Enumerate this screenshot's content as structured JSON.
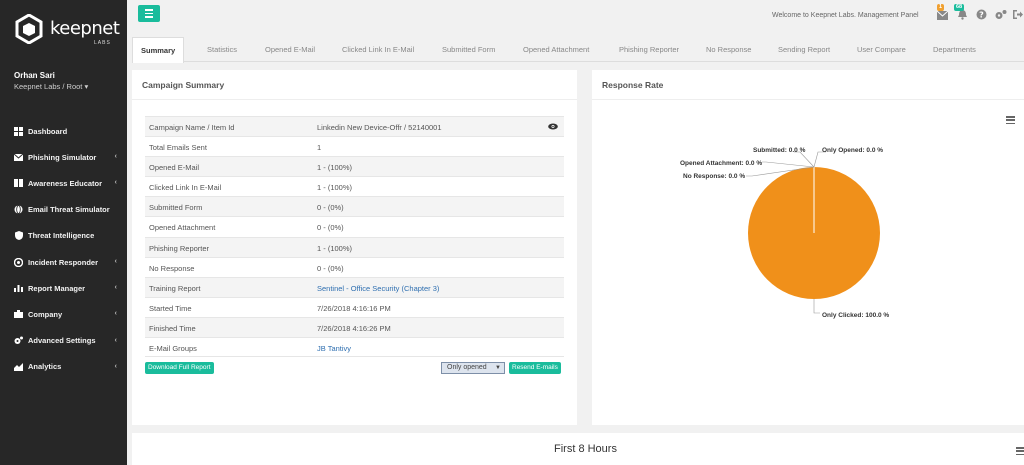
{
  "brand": {
    "name": "keepnet",
    "sub": "LABS"
  },
  "user": {
    "name": "Orhan Sari",
    "org": "Keepnet Labs / Root ▾"
  },
  "sidebar": {
    "items": [
      {
        "label": "Dashboard",
        "icon": "dashboard-icon",
        "has_children": false
      },
      {
        "label": "Phishing Simulator",
        "icon": "envelope-icon",
        "has_children": true
      },
      {
        "label": "Awareness Educator",
        "icon": "book-icon",
        "has_children": true
      },
      {
        "label": "Email Threat Simulator",
        "icon": "globe-icon",
        "has_children": false
      },
      {
        "label": "Threat Intelligence",
        "icon": "shield-icon",
        "has_children": false
      },
      {
        "label": "Incident Responder",
        "icon": "target-icon",
        "has_children": true
      },
      {
        "label": "Report Manager",
        "icon": "bar-chart-icon",
        "has_children": true
      },
      {
        "label": "Company",
        "icon": "building-icon",
        "has_children": true
      },
      {
        "label": "Advanced Settings",
        "icon": "gears-icon",
        "has_children": true
      },
      {
        "label": "Analytics",
        "icon": "area-chart-icon",
        "has_children": true
      }
    ],
    "chevron": "‹"
  },
  "header": {
    "welcome": "Welcome to Keepnet Labs. Management Panel",
    "badge_mail": "1",
    "badge_notifications": "68"
  },
  "tabs": [
    "Summary",
    "Statistics",
    "Opened E-Mail",
    "Clicked Link In E-Mail",
    "Submitted Form",
    "Opened Attachment",
    "Phishing Reporter",
    "No Response",
    "Sending Report",
    "User Compare",
    "Departments"
  ],
  "summary": {
    "title": "Campaign Summary",
    "rows": [
      {
        "key": "Campaign Name / Item Id",
        "value": "Linkedin New Device-Offr / 52140001",
        "link": false
      },
      {
        "key": "Total Emails Sent",
        "value": "1",
        "link": false
      },
      {
        "key": "Opened E-Mail",
        "value": "1 - (100%)",
        "link": false
      },
      {
        "key": "Clicked Link In E-Mail",
        "value": "1 - (100%)",
        "link": false
      },
      {
        "key": "Submitted Form",
        "value": "0 - (0%)",
        "link": false
      },
      {
        "key": "Opened Attachment",
        "value": "0 - (0%)",
        "link": false
      },
      {
        "key": "Phishing Reporter",
        "value": "1 - (100%)",
        "link": false
      },
      {
        "key": "No Response",
        "value": "0 - (0%)",
        "link": false
      },
      {
        "key": "Training Report",
        "value": "Sentinel - Office Security (Chapter 3)",
        "link": true
      },
      {
        "key": "Started Time",
        "value": "7/26/2018 4:16:16 PM",
        "link": false
      },
      {
        "key": "Finished Time",
        "value": "7/26/2018 4:16:26 PM",
        "link": false
      },
      {
        "key": "E-Mail Groups",
        "value": "JB Tantivy",
        "link": true
      }
    ],
    "download_label": "Download Full Report",
    "select_value": "Only opened",
    "resend_label": "Resend E-mails"
  },
  "response_panel": {
    "title": "Response Rate"
  },
  "chart_data": {
    "type": "pie",
    "title": "",
    "slices": [
      {
        "name": "Only Clicked",
        "value": 100.0,
        "label": "Only Clicked: 100.0 %",
        "color": "#f0901a"
      },
      {
        "name": "Submitted",
        "value": 0.0,
        "label": "Submitted: 0.0 %"
      },
      {
        "name": "Only Opened",
        "value": 0.0,
        "label": "Only Opened: 0.0 %"
      },
      {
        "name": "Opened Attachment",
        "value": 0.0,
        "label": "Opened Attachment: 0.0 %"
      },
      {
        "name": "No Response",
        "value": 0.0,
        "label": "No Response: 0.0 %"
      }
    ],
    "legend": "none"
  },
  "bottom": {
    "title": "First 8 Hours"
  },
  "colors": {
    "sidebar_bg": "#272727",
    "accent": "#1abc9c",
    "pie": "#f0901a",
    "link": "#2f6fb0"
  }
}
